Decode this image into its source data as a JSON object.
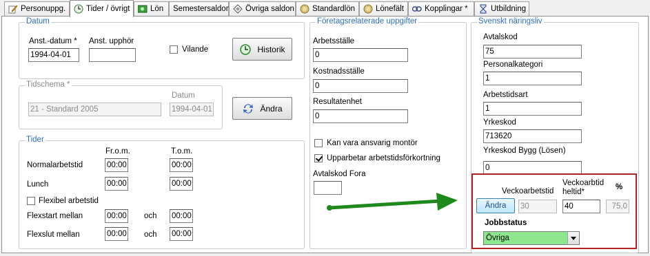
{
  "tabs": [
    {
      "label": "Personuppg.",
      "icon": "pencil-icon"
    },
    {
      "label": "Tider / övrigt",
      "icon": "clock-icon",
      "active": true
    },
    {
      "label": "Lön",
      "icon": "money-icon"
    },
    {
      "label": "Semestersaldon",
      "icon": ""
    },
    {
      "label": "Övriga saldon",
      "icon": "diamond-icon"
    },
    {
      "label": "Standardlön",
      "icon": "coin-icon"
    },
    {
      "label": "Lönefält",
      "icon": "coin-icon"
    },
    {
      "label": "Kopplingar *",
      "icon": "link-icon"
    },
    {
      "label": "Utbildning",
      "icon": "hourglass-icon"
    }
  ],
  "datum": {
    "legend": "Datum",
    "anst_datum_label": "Anst.-datum *",
    "anst_datum_value": "1994-04-01",
    "anst_upphor_label": "Anst. upphör",
    "anst_upphor_value": "",
    "vilande_label": "Vilande",
    "historik_label": "Historik"
  },
  "tidschema": {
    "legend": "Tidschema *",
    "schema_value": "21 - Standard 2005",
    "datum_label": "Datum",
    "datum_value": "1994-04-01",
    "andra_label": "Ändra"
  },
  "tider": {
    "legend": "Tider",
    "from_label": "Fr.o.m.",
    "tom_label": "T.o.m.",
    "rows": [
      {
        "label": "Normalarbetstid",
        "from": "00:00",
        "tom": "00:00"
      },
      {
        "label": "Lunch",
        "from": "00:00",
        "tom": "00:00"
      }
    ],
    "flexibel_label": "Flexibel arbetstid",
    "flexstart_label": "Flexstart mellan",
    "flexstart_from": "00:00",
    "flexstart_to": "00:00",
    "flexslut_label": "Flexslut mellan",
    "flexslut_from": "00:00",
    "flexslut_to": "00:00",
    "och": "och"
  },
  "foretag": {
    "legend": "Företagsrelaterade uppgifter",
    "arbetsstalle_label": "Arbetsställe",
    "arbetsstalle_value": "0",
    "kostnadsstalle_label": "Kostnadsställe",
    "kostnadsstalle_value": "0",
    "resultatenhet_label": "Resultatenhet",
    "resultatenhet_value": "0",
    "montor_label": "Kan vara ansvarig montör",
    "upparbetar_label": "Upparbetar arbetstidsförkortning",
    "avtalskod_fora_label": "Avtalskod Fora",
    "avtalskod_fora_value": ""
  },
  "naringsliv": {
    "legend": "Svenskt näringsliv",
    "avtalskod_label": "Avtalskod",
    "avtalskod_value": "75",
    "personalkategori_label": "Personalkategori",
    "personalkategori_value": "1",
    "arbetstidsart_label": "Arbetstidsart",
    "arbetstidsart_value": "1",
    "yrkeskod_label": "Yrkeskod",
    "yrkeskod_value": "713620",
    "yrkeskod_bygg_label": "Yrkeskod Bygg (Lösen)",
    "yrkeskod_bygg_value": "0",
    "veckoarbetstid_label": "Veckoarbetstid",
    "veckoarbetstid_heltid_label1": "Veckoarbtid",
    "veckoarbetstid_heltid_label2": "heltid*",
    "procent_label": "%",
    "andra_label": "Ändra",
    "veckoarbetstid_value": "30",
    "heltid_value": "40",
    "procent_value": "75,0",
    "jobbstatus_label": "Jobbstatus",
    "jobbstatus_value": "Övriga"
  },
  "colors": {
    "legend_blue": "#2f6fbf",
    "highlight_red": "#b22222",
    "arrow_green": "#1e8a1e",
    "select_green": "#8ee68e"
  }
}
